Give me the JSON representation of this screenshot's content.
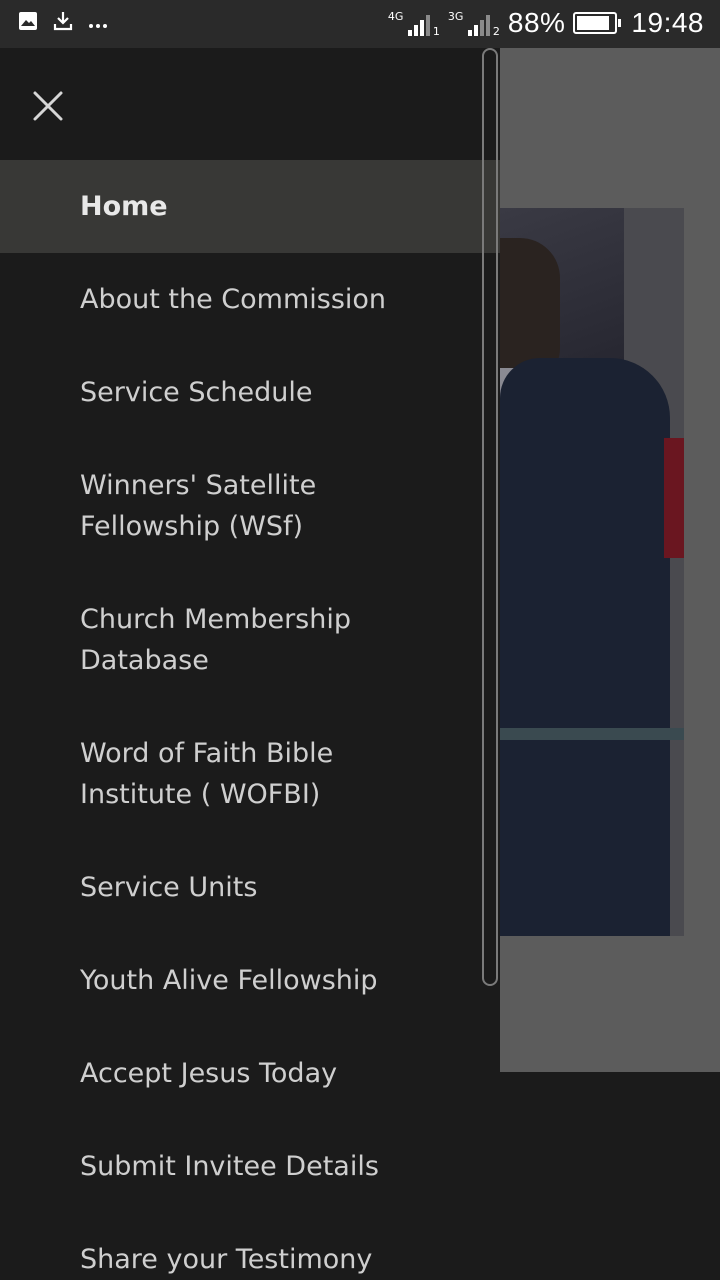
{
  "status_bar": {
    "network1": "4G",
    "sim1": "1",
    "network2": "3G",
    "sim2": "2",
    "battery_percent_label": "88%",
    "battery_level": 0.88,
    "time": "19:48",
    "icons": [
      "image-icon",
      "download-icon",
      "more-icon"
    ]
  },
  "drawer": {
    "close_icon": "close-icon",
    "items": [
      {
        "label": "Home",
        "active": true
      },
      {
        "label": "About the Commission",
        "active": false
      },
      {
        "label": "Service Schedule",
        "active": false
      },
      {
        "label": "Winners' Satellite Fellowship (WSf)",
        "active": false
      },
      {
        "label": "Church Membership Database",
        "active": false
      },
      {
        "label": "Word of Faith Bible Institute ( WOFBI)",
        "active": false
      },
      {
        "label": "Service Units",
        "active": false
      },
      {
        "label": "Youth Alive Fellowship",
        "active": false
      },
      {
        "label": "Accept Jesus Today",
        "active": false
      },
      {
        "label": "Submit Invitee Details",
        "active": false
      },
      {
        "label": "Share your Testimony",
        "active": false
      }
    ]
  },
  "colors": {
    "drawer_bg": "#1b1b1b",
    "active_item_bg": "#383836",
    "item_text": "#cfcfcf",
    "status_bar_bg": "#2a2a2a"
  }
}
